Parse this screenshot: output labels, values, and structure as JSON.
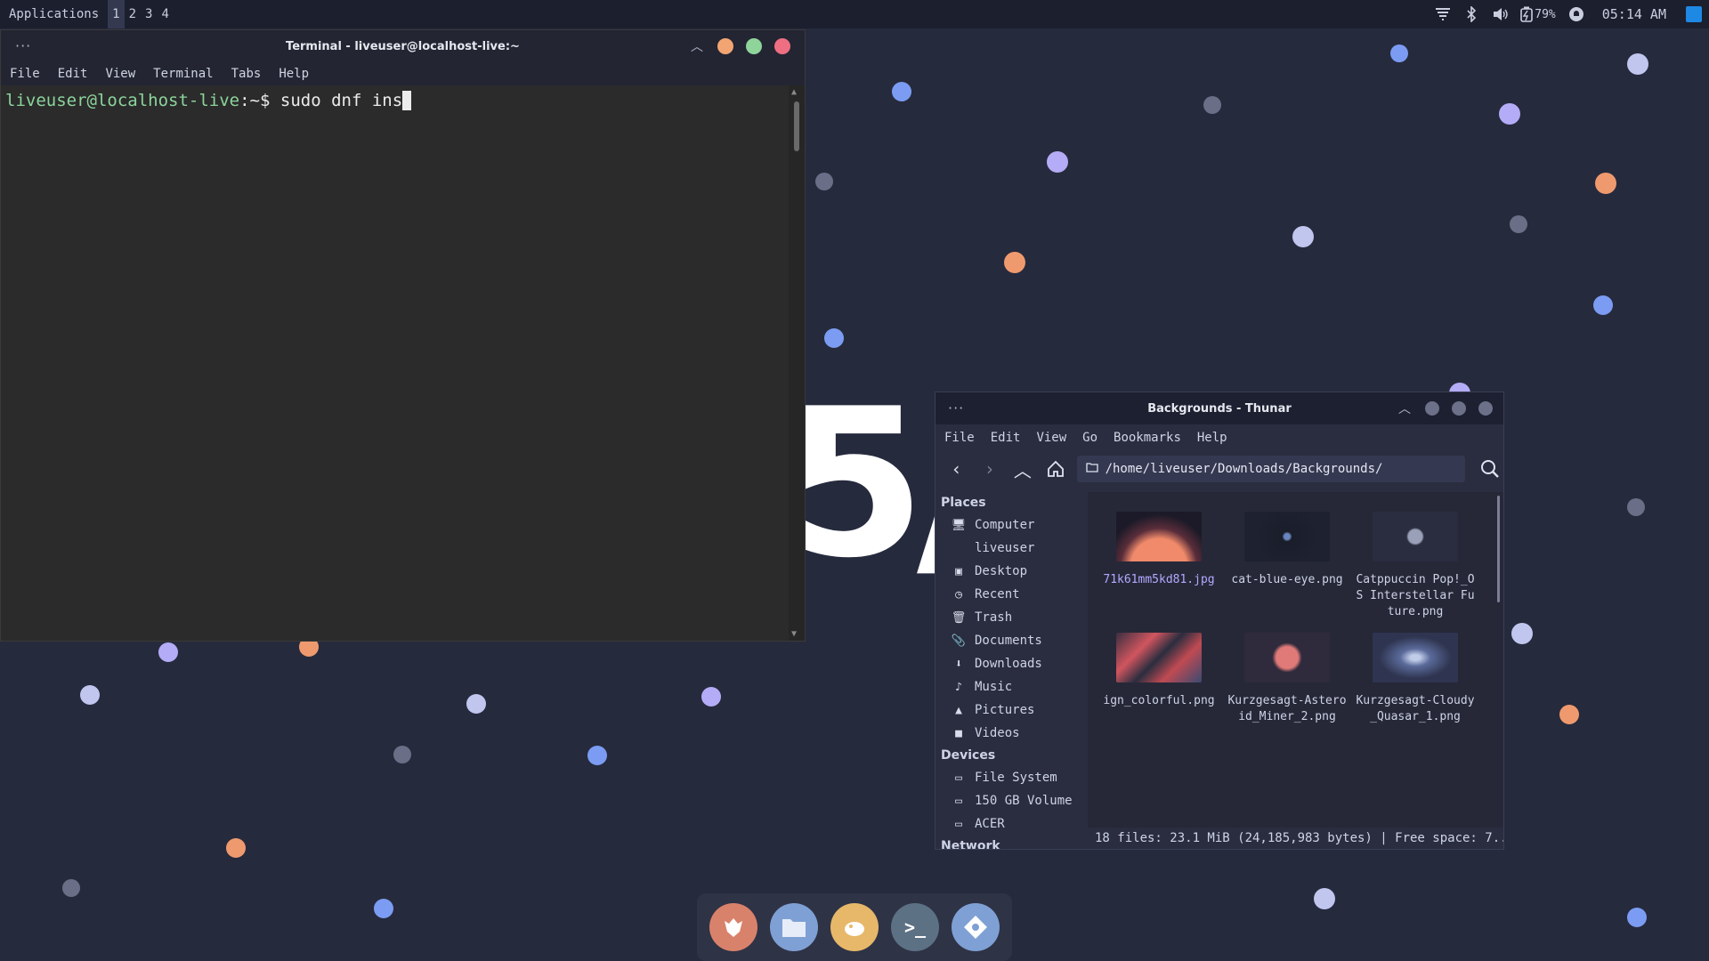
{
  "panel": {
    "applications_label": "Applications",
    "workspaces": [
      "1",
      "2",
      "3",
      "4"
    ],
    "battery": "79%",
    "clock": "05:14 AM"
  },
  "wallpaper": {
    "text": "5/"
  },
  "terminal": {
    "title": "Terminal - liveuser@localhost-live:~",
    "menu": [
      "File",
      "Edit",
      "View",
      "Terminal",
      "Tabs",
      "Help"
    ],
    "prompt_user": "liveuser@localhost-live",
    "prompt_path": ":~$ ",
    "command": "sudo dnf ins"
  },
  "thunar": {
    "title": "Backgrounds - Thunar",
    "menu": [
      "File",
      "Edit",
      "View",
      "Go",
      "Bookmarks",
      "Help"
    ],
    "path": "/home/liveuser/Downloads/Backgrounds/",
    "places_header": "Places",
    "places": [
      "Computer",
      "liveuser",
      "Desktop",
      "Recent",
      "Trash",
      "Documents",
      "Downloads",
      "Music",
      "Pictures",
      "Videos"
    ],
    "devices_header": "Devices",
    "devices": [
      "File System",
      "150 GB Volume",
      "ACER"
    ],
    "network_header": "Network",
    "files": [
      {
        "name": "71k61mm5kd81.jpg",
        "color": "#3b2a3a"
      },
      {
        "name": "cat-blue-eye.png",
        "color": "#1e2130"
      },
      {
        "name": "Catppuccin Pop!_OS Interstellar Future.png",
        "color": "#2a2d3f"
      },
      {
        "name": "ign_colorful.png",
        "color": "#b04a52"
      },
      {
        "name": "Kurzgesagt-Asteroid_Miner_2.png",
        "color": "#2f2a3c"
      },
      {
        "name": "Kurzgesagt-Cloudy_Quasar_1.png",
        "color": "#2f3550"
      }
    ],
    "status": "18 files: 23.1 MiB (24,185,983 bytes)  |  Free space: 7..."
  },
  "dock": {
    "items": [
      "firefox-icon",
      "files-icon",
      "gimp-icon",
      "terminal-icon",
      "settings-icon"
    ]
  }
}
